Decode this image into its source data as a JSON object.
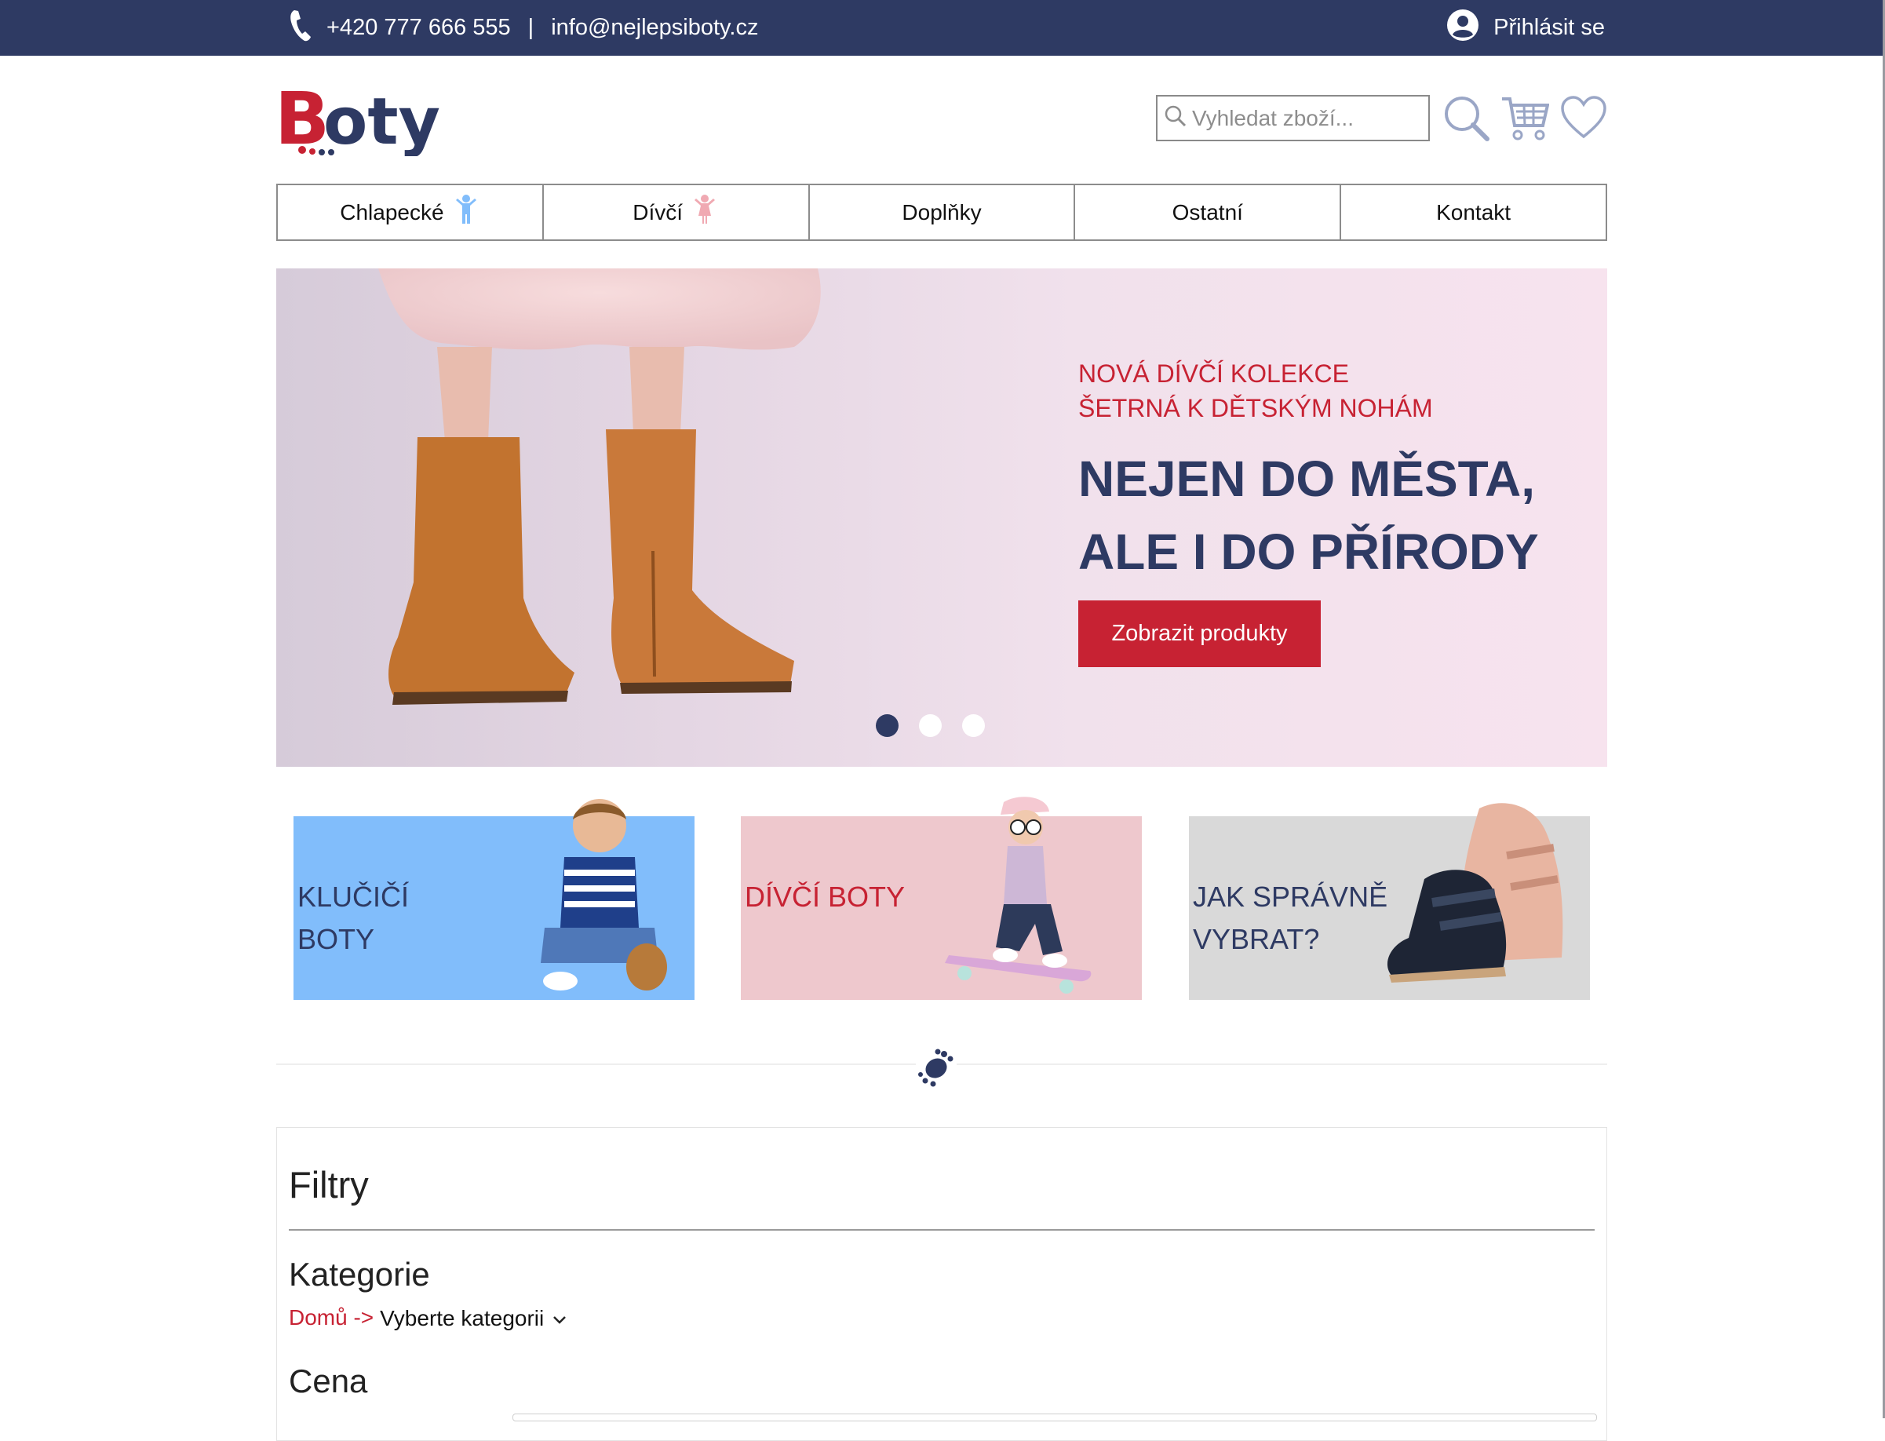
{
  "colors": {
    "navy": "#2e3a63",
    "red": "#c72233",
    "boy_blue": "#81bdfb",
    "girl_pink": "#eec8cd",
    "grey": "#d9d9d9"
  },
  "topbar": {
    "phone": "+420 777 666 555",
    "separator": "|",
    "email": "info@nejlepsiboty.cz",
    "login_label": "Přihlásit se",
    "icons": [
      "phone-icon",
      "user-icon"
    ]
  },
  "header": {
    "logo_text": "Boty",
    "search_placeholder": "Vyhledat zboží...",
    "icons": [
      "search-icon",
      "cart-icon",
      "heart-icon"
    ]
  },
  "nav": {
    "items": [
      {
        "label": "Chlapecké",
        "icon": "boy-figure-icon"
      },
      {
        "label": "Dívčí",
        "icon": "girl-figure-icon"
      },
      {
        "label": "Doplňky"
      },
      {
        "label": "Ostatní"
      },
      {
        "label": "Kontakt"
      }
    ]
  },
  "hero": {
    "tag_line1": "NOVÁ DÍVČÍ KOLEKCE",
    "tag_line2": "ŠETRNÁ K DĚTSKÝM NOHÁM",
    "headline_line1": "NEJEN DO MĚSTA,",
    "headline_line2": "ALE I DO PŘÍRODY",
    "cta_label": "Zobrazit produkty",
    "slides": 3,
    "active_slide": 1
  },
  "categories": [
    {
      "line1": "KLUČIČÍ",
      "line2": "BOTY"
    },
    {
      "line1": "DÍVČÍ BOTY",
      "line2": ""
    },
    {
      "line1": "JAK SPRÁVNĚ",
      "line2": "VYBRAT?"
    }
  ],
  "filters": {
    "title": "Filtry",
    "category_title": "Kategorie",
    "breadcrumb_home": "Domů ->",
    "category_select": "Vyberte kategorii",
    "price_title": "Cena"
  }
}
